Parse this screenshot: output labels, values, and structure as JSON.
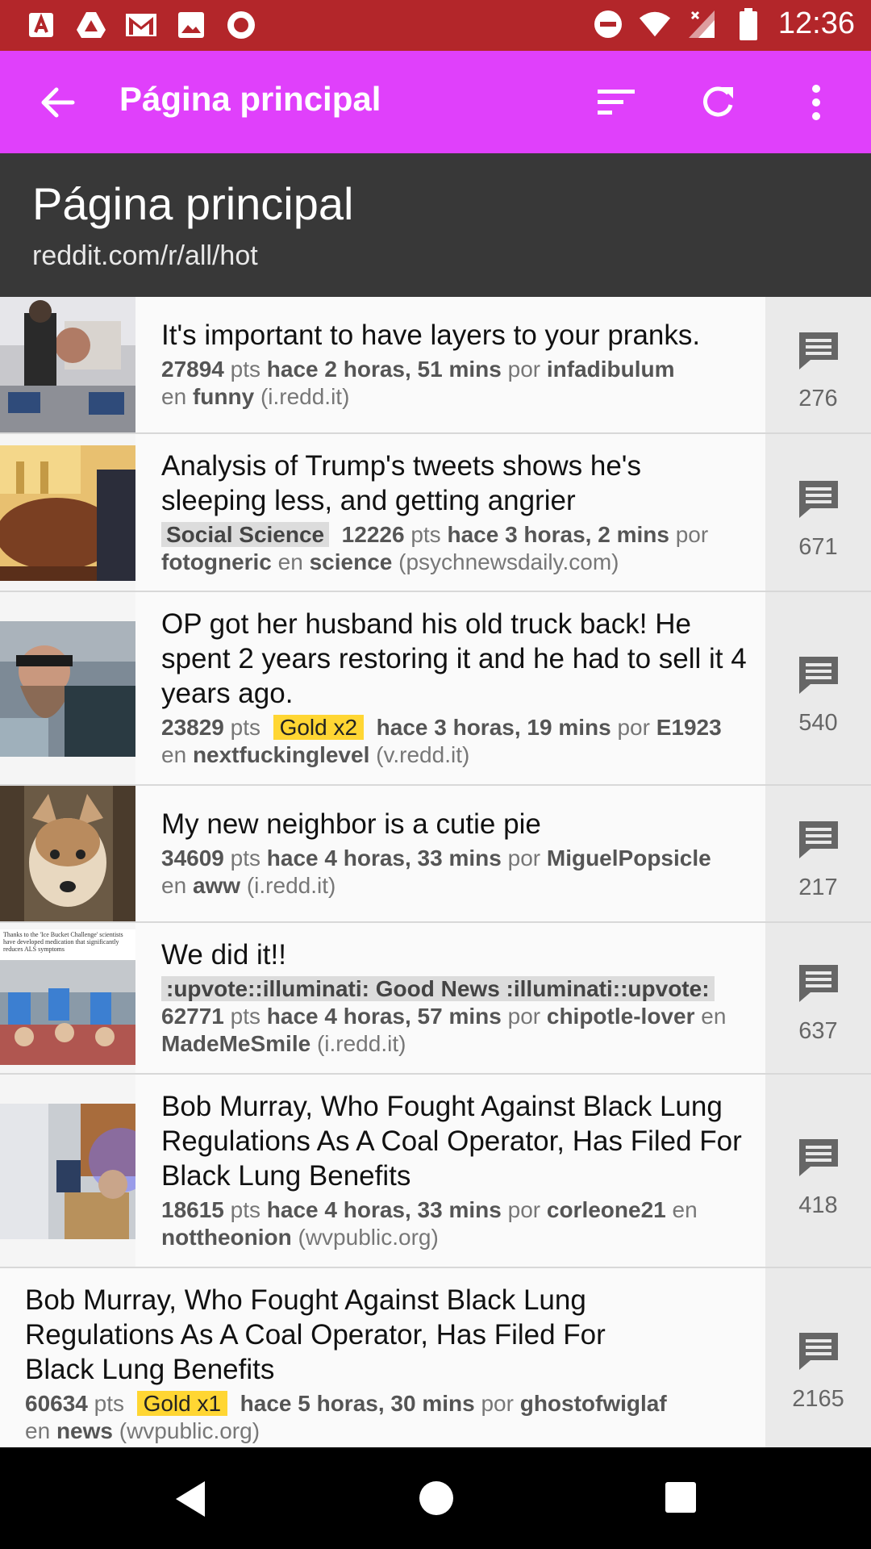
{
  "status_bar": {
    "time": "12:36",
    "left_icons": [
      "acrobat-icon",
      "drive-icon",
      "gmail-icon",
      "photos-icon",
      "record-icon"
    ],
    "right_icons": [
      "do-not-disturb-icon",
      "wifi-icon",
      "signal-icon",
      "battery-icon"
    ]
  },
  "app_bar": {
    "title": "Página principal",
    "actions": [
      "sort-icon",
      "refresh-icon",
      "more-vert-icon"
    ],
    "color": "#e040fb"
  },
  "header": {
    "title": "Página principal",
    "subtitle": "reddit.com/r/all/hot"
  },
  "labels": {
    "pts": "pts",
    "en": "en",
    "por": "por"
  },
  "posts": [
    {
      "title": "It's important to have layers to your pranks.",
      "score": "27894",
      "time": "hace 2 horas, 51 mins",
      "author": "infadibulum",
      "subreddit": "funny",
      "domain": "(i.redd.it)",
      "comments": "276"
    },
    {
      "title": "Analysis of Trump's tweets shows he's sleeping less, and getting angrier",
      "flair": "Social Science",
      "score": "12226",
      "time": "hace 3 horas, 2 mins",
      "author": "fotogneric",
      "subreddit": "science",
      "domain": "(psychnewsdaily.com)",
      "comments": "671"
    },
    {
      "title": "OP got her husband his old truck back! He spent 2 years restoring it and he had to sell it 4 years ago.",
      "score": "23829",
      "gold": "Gold x2",
      "time": "hace 3 horas, 19 mins",
      "author": "E1923",
      "subreddit": "nextfuckinglevel",
      "domain": "(v.redd.it)",
      "comments": "540"
    },
    {
      "title": "My new neighbor is a cutie pie",
      "score": "34609",
      "time": "hace 4 horas, 33 mins",
      "author": "MiguelPopsicle",
      "subreddit": "aww",
      "domain": "(i.redd.it)",
      "comments": "217"
    },
    {
      "title": "We did it!!",
      "flair": ":upvote::illuminati: Good News :illuminati::upvote:",
      "score": "62771",
      "time": "hace 4 horas, 57 mins",
      "author": "chipotle-lover",
      "subreddit": "MadeMeSmile",
      "domain": "(i.redd.it)",
      "comments": "637",
      "thumb_text": "Thanks to the 'Ice Bucket Challenge' scientists have developed medication that significantly reduces ALS symptoms"
    },
    {
      "title": "Bob Murray, Who Fought Against Black Lung Regulations As A Coal Operator, Has Filed For Black Lung Benefits",
      "score": "18615",
      "time": "hace 4 horas, 33 mins",
      "author": "corleone21",
      "subreddit": "nottheonion",
      "domain": "(wvpublic.org)",
      "comments": "418"
    },
    {
      "title": "Bob Murray, Who Fought Against Black Lung Regulations As A Coal Operator, Has Filed For Black Lung Benefits",
      "score": "60634",
      "gold": "Gold x1",
      "time": "hace 5 horas, 30 mins",
      "author": "ghostofwiglaf",
      "subreddit": "news",
      "domain": "(wvpublic.org)",
      "comments": "2165"
    }
  ],
  "nav_bar": [
    "back-nav-icon",
    "home-nav-icon",
    "recents-nav-icon"
  ]
}
